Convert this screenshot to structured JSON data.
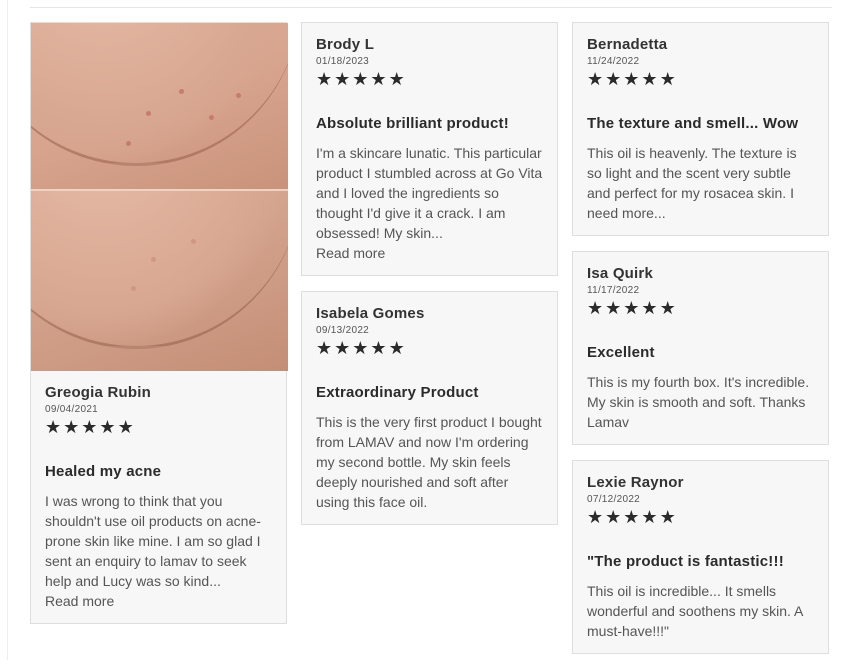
{
  "reviews": {
    "r1": {
      "name": "Greogia Rubin",
      "date": "09/04/2021",
      "rating": 5,
      "title": "Healed my acne",
      "text": "I was wrong to think that you shouldn't use oil products on acne-prone skin like mine. I am so glad I sent an enquiry to lamav to seek help and Lucy was so kind...",
      "read_more": "Read more"
    },
    "r2": {
      "name": "Brody L",
      "date": "01/18/2023",
      "rating": 5,
      "title": "Absolute brilliant product!",
      "text": "I'm a skincare lunatic. This particular product I stumbled across at Go Vita and I loved the ingredients so thought I'd give it a crack. I am obsessed! My skin...",
      "read_more": "Read more"
    },
    "r3": {
      "name": "Isabela Gomes",
      "date": "09/13/2022",
      "rating": 5,
      "title": "Extraordinary Product",
      "text": "This is the very first product I bought from LAMAV and now I'm ordering my second bottle. My skin feels deeply nourished and soft after using this face oil."
    },
    "r4": {
      "name": "Bernadetta",
      "date": "11/24/2022",
      "rating": 5,
      "title": "The texture and smell... Wow",
      "text": "This oil is heavenly. The texture is so light and the scent very subtle and perfect for my rosacea skin. I need more..."
    },
    "r5": {
      "name": "Isa Quirk",
      "date": "11/17/2022",
      "rating": 5,
      "title": "Excellent",
      "text": "This is my fourth box. It's incredible. My skin is smooth and soft. Thanks Lamav"
    },
    "r6": {
      "name": "Lexie Raynor",
      "date": "07/12/2022",
      "rating": 5,
      "title": "\"The product is fantastic!!!",
      "text": "This oil is incredible... It smells wonderful and soothens my skin. A must-have!!!\""
    }
  },
  "star_glyph": "★",
  "colors": {
    "card_bg": "#f7f7f7",
    "card_border": "#dedede",
    "star": "#2b2b2b"
  }
}
